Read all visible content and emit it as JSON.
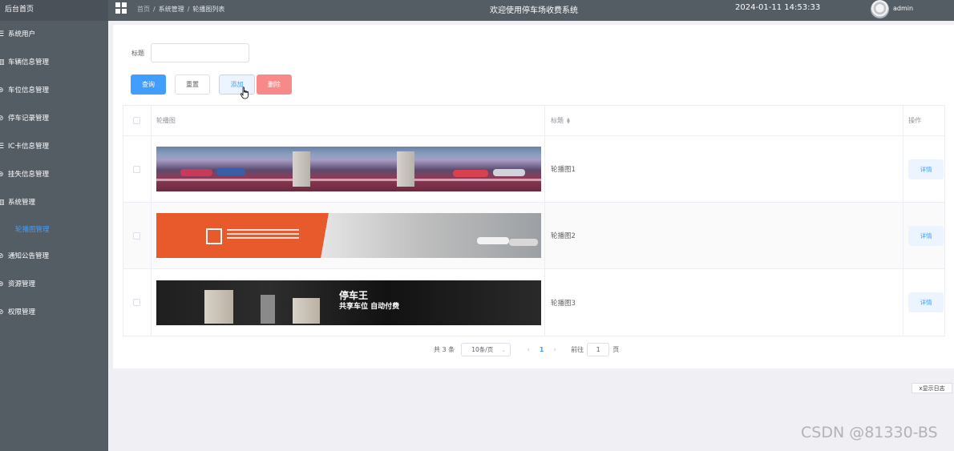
{
  "sidebar": {
    "home": "后台首页",
    "items": [
      {
        "label": "系统用户",
        "icon": "list-icon"
      },
      {
        "label": "车辆信息管理",
        "icon": "bar-chart-icon"
      },
      {
        "label": "车位信息管理",
        "icon": "message-icon"
      },
      {
        "label": "停车记录管理",
        "icon": "check-circle-icon"
      },
      {
        "label": "IC卡信息管理",
        "icon": "list-icon"
      },
      {
        "label": "挂失信息管理",
        "icon": "message-icon"
      },
      {
        "label": "系统管理",
        "icon": "bar-chart-icon"
      },
      {
        "label": "轮播图管理",
        "icon": "",
        "active": true
      },
      {
        "label": "通知公告管理",
        "icon": "check-circle-icon"
      },
      {
        "label": "资源管理",
        "icon": "message-icon"
      },
      {
        "label": "权限管理",
        "icon": "check-circle-icon"
      }
    ]
  },
  "topbar": {
    "breadcrumb": [
      "首页",
      "系统管理",
      "轮播图列表"
    ],
    "welcome": "欢迎使用停车场收费系统",
    "datetime": "2024-01-11 14:53:33",
    "user": "admin"
  },
  "filter": {
    "label": "标题",
    "value": ""
  },
  "buttons": {
    "query": "查询",
    "reset": "重置",
    "add": "添加",
    "delete": "删除"
  },
  "table": {
    "columns": [
      "轮播图",
      "标题",
      "操作"
    ],
    "rows": [
      {
        "title": "轮播图1",
        "action": "详情"
      },
      {
        "title": "轮播图2",
        "action": "详情"
      },
      {
        "title": "轮播图3",
        "action": "详情"
      }
    ]
  },
  "banner3_text": {
    "line1": "停车王",
    "line2": "共享车位 自动付费"
  },
  "pagination": {
    "total": "共 3 条",
    "page_size": "10条/页",
    "current": "1",
    "goto_prefix": "前往",
    "goto_value": "1",
    "goto_suffix": "页"
  },
  "log_button": "x显示日志",
  "watermark": "CSDN @81330-BS",
  "colors": {
    "sidebar": "#545c64",
    "primary": "#409eff",
    "danger": "#f78989"
  }
}
